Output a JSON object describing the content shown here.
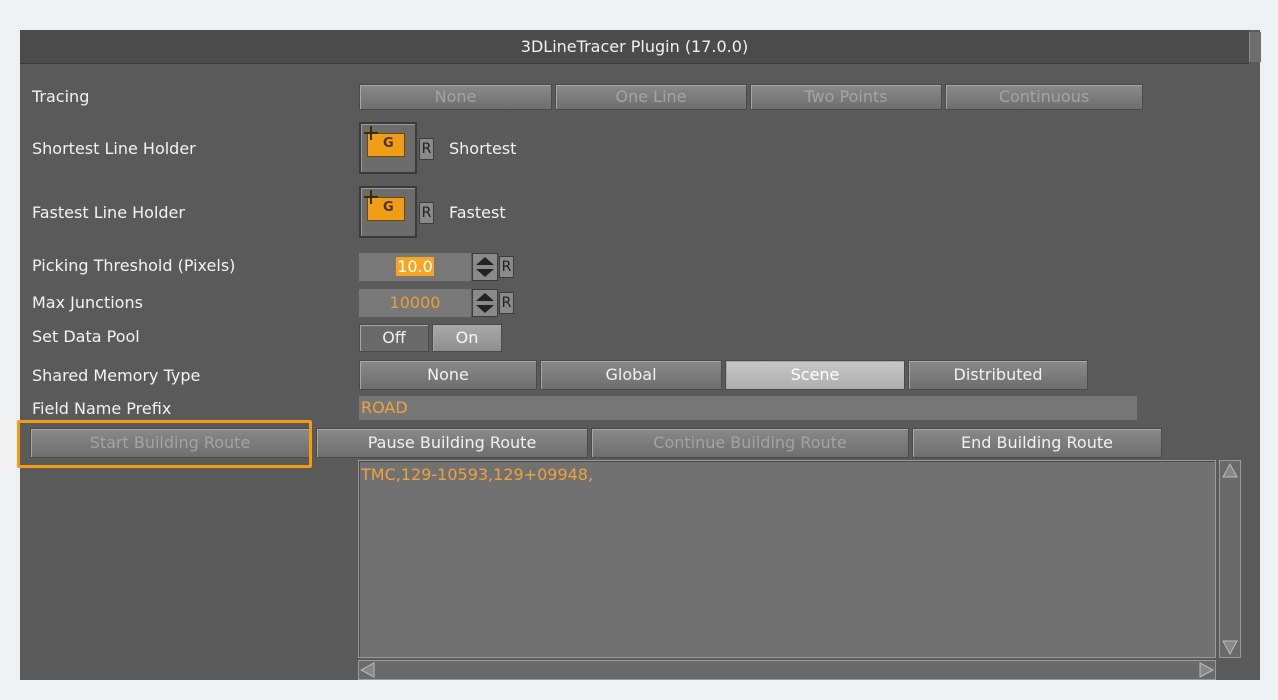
{
  "title": "3DLineTracer Plugin (17.0.0)",
  "rows": {
    "tracing": {
      "label": "Tracing",
      "options": [
        "None",
        "One Line",
        "Two Points",
        "Continuous"
      ]
    },
    "shortest": {
      "label": "Shortest Line Holder",
      "reset": "R",
      "name": "Shortest",
      "icon_letter": "G"
    },
    "fastest": {
      "label": "Fastest Line Holder",
      "reset": "R",
      "name": "Fastest",
      "icon_letter": "G"
    },
    "picking": {
      "label": "Picking Threshold (Pixels)",
      "value": "10.0",
      "reset": "R"
    },
    "junctions": {
      "label": "Max Junctions",
      "value": "10000",
      "reset": "R"
    },
    "datapool": {
      "label": "Set Data Pool",
      "off": "Off",
      "on": "On",
      "selected": "Off"
    },
    "memory": {
      "label": "Shared  Memory Type",
      "options": [
        "None",
        "Global",
        "Scene",
        "Distributed"
      ],
      "selected": "Scene"
    },
    "prefix": {
      "label": "Field Name Prefix",
      "value": "ROAD"
    }
  },
  "route_buttons": [
    "Start Building Route",
    "Pause Building Route",
    "Continue Building Route",
    "End Building Route"
  ],
  "output_text": "TMC,129-10593,129+09948,",
  "colors": {
    "highlight": "#f39c12",
    "value_text": "#f0a23c"
  }
}
